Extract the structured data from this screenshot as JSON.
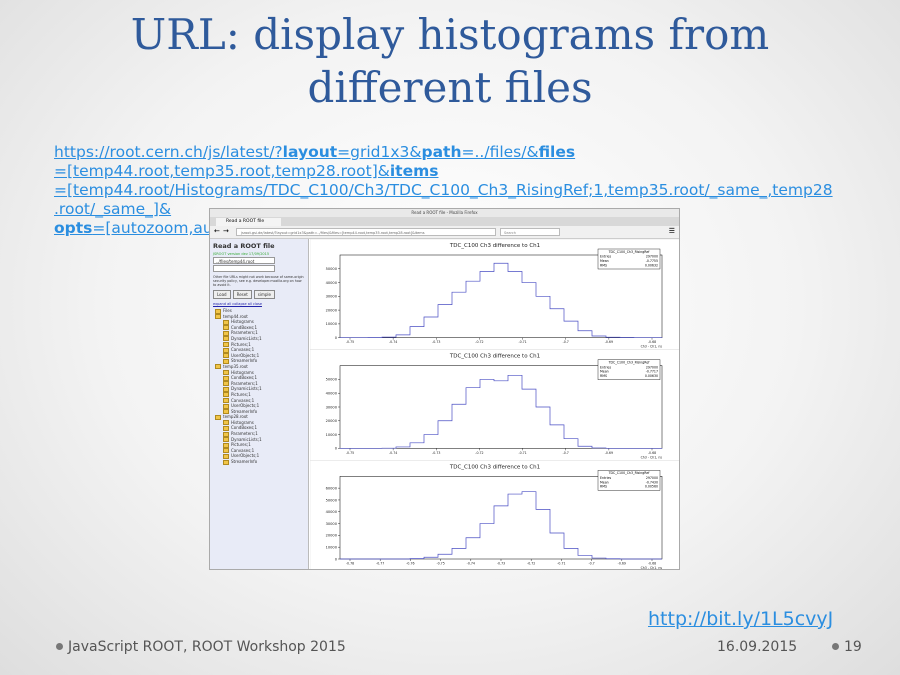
{
  "slide": {
    "title_line1": "URL: display histograms from",
    "title_line2": "different files",
    "url_lines": [
      [
        {
          "t": "https://root.cern.ch/js/latest/?"
        },
        {
          "t": "layout",
          "b": true
        },
        {
          "t": "=grid1x3&"
        },
        {
          "t": "path",
          "b": true
        },
        {
          "t": "=../files/&"
        },
        {
          "t": "files",
          "b": true
        }
      ],
      [
        {
          "t": "=[temp44.root,temp35.root,temp28.root]&"
        },
        {
          "t": "items",
          "b": true
        }
      ],
      [
        {
          "t": "=[temp44.root/Histograms/TDC_C100/Ch3/TDC_C100_Ch3_RisingRef;1,temp35.root/_same_,temp28"
        }
      ],
      [
        {
          "t": ".root/_same_]&"
        }
      ],
      [
        {
          "t": "opts",
          "b": true
        },
        {
          "t": "=[autozoom,autozoom,autozoom]"
        }
      ]
    ],
    "short_link": "http://bit.ly/1L5cvyJ",
    "footer_left": "JavaScript ROOT, ROOT Workshop 2015",
    "footer_date": "16.09.2015",
    "footer_page": "19"
  },
  "browser": {
    "window_title": "Read a ROOT file - Mozilla Firefox",
    "tab_label": "Read a ROOT file",
    "address": "jsroot.gsi.de/latest/?layout=grid1x3&path=../files/&files=[temp44.root,temp35.root,temp28.root]&items",
    "search_placeholder": "Search"
  },
  "left_panel": {
    "heading": "Read a ROOT file",
    "version": "JSROOT version dev 17/09/2015",
    "file_input": "../files/temp44.root",
    "note": "Other file URLs might not work because of same-origin security policy, see e.g. developer.mozilla.org on how to avoid it.",
    "buttons": [
      "Load",
      "Reset",
      "simple"
    ],
    "links": "expand all  collapse all  close",
    "tree": [
      {
        "label": "Files",
        "lvl": 0
      },
      {
        "label": "temp44.root",
        "lvl": 0
      },
      {
        "label": "Histograms",
        "lvl": 1
      },
      {
        "label": "CondBoxes;1",
        "lvl": 1
      },
      {
        "label": "Parameters;1",
        "lvl": 1
      },
      {
        "label": "DynamicLists;1",
        "lvl": 1
      },
      {
        "label": "Pictures;1",
        "lvl": 1
      },
      {
        "label": "Canvases;1",
        "lvl": 1
      },
      {
        "label": "UserObjects;1",
        "lvl": 1
      },
      {
        "label": "StreamerInfo",
        "lvl": 1
      },
      {
        "label": "temp35.root",
        "lvl": 0
      },
      {
        "label": "Histograms",
        "lvl": 1
      },
      {
        "label": "CondBoxes;1",
        "lvl": 1
      },
      {
        "label": "Parameters;1",
        "lvl": 1
      },
      {
        "label": "DynamicLists;1",
        "lvl": 1
      },
      {
        "label": "Pictures;1",
        "lvl": 1
      },
      {
        "label": "Canvases;1",
        "lvl": 1
      },
      {
        "label": "UserObjects;1",
        "lvl": 1
      },
      {
        "label": "StreamerInfo",
        "lvl": 1
      },
      {
        "label": "temp28.root",
        "lvl": 0
      },
      {
        "label": "Histograms",
        "lvl": 1
      },
      {
        "label": "CondBoxes;1",
        "lvl": 1
      },
      {
        "label": "Parameters;1",
        "lvl": 1
      },
      {
        "label": "DynamicLists;1",
        "lvl": 1
      },
      {
        "label": "Pictures;1",
        "lvl": 1
      },
      {
        "label": "Canvases;1",
        "lvl": 1
      },
      {
        "label": "UserObjects;1",
        "lvl": 1
      },
      {
        "label": "StreamerInfo",
        "lvl": 1
      }
    ]
  },
  "chart_data": [
    {
      "type": "bar",
      "title": "TDC_C100 Ch3 difference to Ch1",
      "xlabel": "Ch3 - Ch1, ns",
      "ylim": [
        0,
        60000
      ],
      "yticks": [
        0,
        10000,
        20000,
        30000,
        40000,
        50000
      ],
      "xticks": [
        "-0.75",
        "-0.74",
        "-0.73",
        "-0.72",
        "-0.71",
        "-0.7",
        "-0.69",
        "-0.68"
      ],
      "values": [
        0,
        0,
        50,
        400,
        2000,
        8000,
        15000,
        24000,
        33000,
        41000,
        48000,
        54000,
        48000,
        40000,
        30000,
        21000,
        12000,
        5000,
        1200,
        300,
        100,
        0,
        0
      ],
      "stats": {
        "name": "TDC_C100_Ch3_RisingRef",
        "entries": "297000",
        "mean": "-0.7755",
        "rms": "0.00632"
      },
      "color": "#4a4fc4"
    },
    {
      "type": "bar",
      "title": "TDC_C100 Ch3 difference to Ch1",
      "xlabel": "Ch3 - Ch1, ns",
      "ylim": [
        0,
        60000
      ],
      "yticks": [
        0,
        10000,
        20000,
        30000,
        40000,
        50000
      ],
      "xticks": [
        "-0.75",
        "-0.74",
        "-0.73",
        "-0.72",
        "-0.71",
        "-0.7",
        "-0.69",
        "-0.68"
      ],
      "values": [
        0,
        0,
        0,
        100,
        1000,
        4000,
        10000,
        20000,
        32000,
        44000,
        50000,
        49000,
        53000,
        43000,
        30000,
        17000,
        7000,
        1500,
        300,
        0,
        0,
        0,
        0
      ],
      "stats": {
        "name": "TDC_C100_Ch3_RisingRef",
        "entries": "297000",
        "mean": "-0.7717",
        "rms": "0.00630"
      },
      "color": "#4a4fc4"
    },
    {
      "type": "bar",
      "title": "TDC_C100 Ch3 difference to Ch1",
      "xlabel": "Ch3 - Ch1, ns",
      "ylim": [
        0,
        70000
      ],
      "yticks": [
        0,
        10000,
        20000,
        30000,
        40000,
        50000,
        60000
      ],
      "xticks": [
        "-0.78",
        "-0.77",
        "-0.76",
        "-0.75",
        "-0.74",
        "-0.73",
        "-0.72",
        "-0.71",
        "-0.7",
        "-0.69",
        "-0.68"
      ],
      "values": [
        0,
        0,
        0,
        0,
        0,
        300,
        1500,
        4000,
        9000,
        18000,
        30000,
        45000,
        55000,
        57000,
        42000,
        22000,
        9000,
        3000,
        800,
        200,
        0,
        0,
        0
      ],
      "stats": {
        "name": "TDC_C100_Ch3_RisingRef",
        "entries": "297000",
        "mean": "-0.7430",
        "rms": "0.00560"
      },
      "color": "#4a4fc4"
    }
  ]
}
